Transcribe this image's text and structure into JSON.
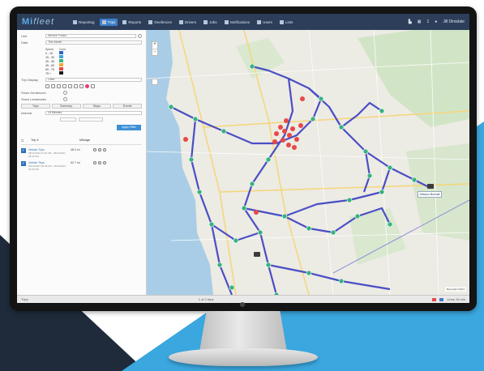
{
  "brand": {
    "logo_prefix": "Mi",
    "logo_rest": "fleet"
  },
  "topnav": {
    "items": [
      {
        "label": "Reporting",
        "active": false
      },
      {
        "label": "Trips",
        "active": true
      },
      {
        "label": "Reports",
        "active": false
      },
      {
        "label": "Geofences",
        "active": false
      },
      {
        "label": "Drivers",
        "active": false
      },
      {
        "label": "Jobs",
        "active": false
      },
      {
        "label": "Notifications",
        "active": false
      },
      {
        "label": "Users",
        "active": false
      },
      {
        "label": "Lists",
        "active": false
      }
    ],
    "right": {
      "count": "1",
      "user": "Jill Dinsdale"
    }
  },
  "sidebar": {
    "unit_label": "Unit",
    "unit_value": "Service Trucks",
    "date_label": "Date",
    "date_value": "This Month",
    "legend": {
      "col_speed": "Speed",
      "col_color": "Color",
      "rows": [
        {
          "speed": "0 - 15",
          "color": "#2e63c8"
        },
        {
          "speed": "15 - 30",
          "color": "#3aa7df"
        },
        {
          "speed": "30 - 45",
          "color": "#36b37e"
        },
        {
          "speed": "45 - 60",
          "color": "#f2a533"
        },
        {
          "speed": "60 - 75",
          "color": "#e84848"
        },
        {
          "speed": "75 +",
          "color": "#1b1b1b"
        }
      ]
    },
    "trip_display_label": "Trip Display",
    "trip_display_value": "Lines",
    "show_geofences_label": "Show Geofences",
    "show_landmarks_label": "Show Landmarks",
    "tabs": [
      "Trips",
      "Summary",
      "Stops",
      "Events"
    ],
    "interval_label": "Interval",
    "interval_value": "15 Minutes",
    "apply_label": "Apply Filter",
    "table_header": {
      "trip": "Trip #",
      "distance": "Mileage"
    },
    "trips": [
      {
        "title": "Vehicle Trips",
        "detail": "05/11/2021 07:02 AM - 05/11/2021 05:40 PM",
        "distance": "48.3 mi"
      },
      {
        "title": "Vehicle Trips",
        "detail": "05/12/2021 06:48 AM - 05/12/2021 04:55 PM",
        "distance": "52.7 mi"
      }
    ]
  },
  "map": {
    "marker_label": "Mission Bonsall",
    "copyright": "Map data ©2021"
  },
  "bottombar": {
    "left": "Trips",
    "center": "1 of 2 trips",
    "right": "Lines 15 min"
  },
  "colors": {
    "nav_bg": "#2c3e5a",
    "accent": "#3d7ec9",
    "route": "#4b4ec4",
    "marker_green": "#36b37e",
    "marker_red": "#e84848",
    "bg_blue": "#3aa7df",
    "bg_navy": "#1f2a3a"
  }
}
